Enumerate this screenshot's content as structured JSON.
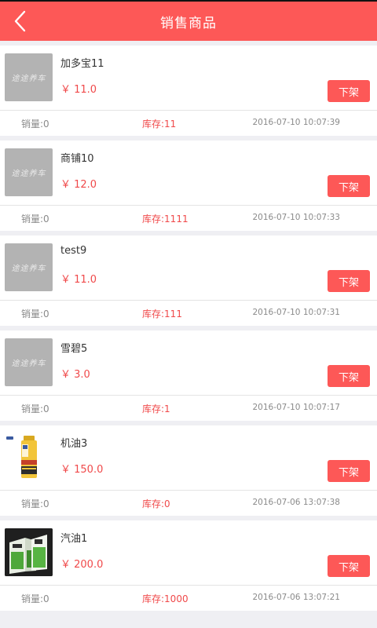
{
  "header": {
    "title": "销售商品"
  },
  "placeholder_text": "途途养车",
  "products": [
    {
      "name": "加多宝11",
      "price": "￥ 11.0",
      "action": "下架",
      "sales": "销量:0",
      "stock": "库存:11",
      "date": "2016-07-10 10:07:39",
      "thumb": "placeholder"
    },
    {
      "name": "商铺10",
      "price": "￥ 12.0",
      "action": "下架",
      "sales": "销量:0",
      "stock": "库存:1111",
      "date": "2016-07-10 10:07:33",
      "thumb": "placeholder"
    },
    {
      "name": "test9",
      "price": "￥ 11.0",
      "action": "下架",
      "sales": "销量:0",
      "stock": "库存:111",
      "date": "2016-07-10 10:07:31",
      "thumb": "placeholder"
    },
    {
      "name": "雪碧5",
      "price": "￥ 3.0",
      "action": "下架",
      "sales": "销量:0",
      "stock": "库存:1",
      "date": "2016-07-10 10:07:17",
      "thumb": "placeholder"
    },
    {
      "name": "机油3",
      "price": "￥ 150.0",
      "action": "下架",
      "sales": "销量:0",
      "stock": "库存:0",
      "date": "2016-07-06 13:07:38",
      "thumb": "oil"
    },
    {
      "name": "汽油1",
      "price": "￥ 200.0",
      "action": "下架",
      "sales": "销量:0",
      "stock": "库存:1000",
      "date": "2016-07-06 13:07:21",
      "thumb": "gas"
    }
  ],
  "colors": {
    "accent": "#fd5857",
    "price": "#f0494a",
    "muted": "#8a8a8a",
    "background": "#efeff3"
  },
  "icons": {
    "back": "chevron-left-icon"
  }
}
